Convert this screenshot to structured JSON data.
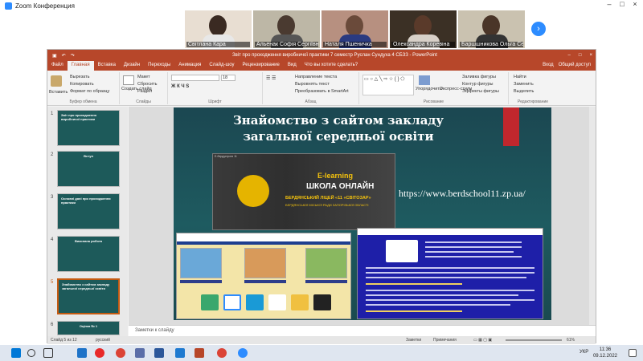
{
  "zoom": {
    "window_title": "Zoom Конференция",
    "participants": [
      {
        "name": "Світлана Кара",
        "bg": "#e8ded2",
        "hair": "#3a2a22",
        "shirt": "#e8e8e8"
      },
      {
        "name": "Альенак Софія Сергіївна",
        "bg": "#bdb7a6",
        "hair": "#4a3a30",
        "shirt": "#555555"
      },
      {
        "name": "Наталя Пшеничка",
        "bg": "#b79080",
        "hair": "#6a4a3a",
        "shirt": "#2a3a80"
      },
      {
        "name": "Олександра Коревіна",
        "bg": "#3b3025",
        "hair": "#5a3a2a",
        "shirt": "#d8d0c8"
      },
      {
        "name": "Баршшникова Ольга Сер...",
        "bg": "#cac2b0",
        "hair": "#4a3528",
        "shirt": "#333333"
      }
    ],
    "next_icon": "chevron-right-icon"
  },
  "ppt": {
    "title": "Звіт про проходження виробничої практики 7 семестр Руслан Сундуха 4 СБЗЗ - PowerPoint",
    "tabs": [
      "Файл",
      "Главная",
      "Вставка",
      "Дизайн",
      "Переходы",
      "Анимация",
      "Слайд-шоу",
      "Рецензирование",
      "Вид",
      "Что вы хотите сделать?"
    ],
    "active_tab": "Главная",
    "tab_right": [
      "Вход",
      "Общий доступ"
    ],
    "ribbon": {
      "paste": "Вставить",
      "cut": "Вырезать",
      "copy": "Копировать",
      "format_painter": "Формат по образцу",
      "clipboard_group": "Буфер обмена",
      "new_slide": "Создать слайд",
      "layout": "Макет",
      "reset": "Сбросить",
      "section": "Раздел",
      "slides_group": "Слайды",
      "font_size": "18",
      "font_group": "Шрифт",
      "text_direction": "Направление текста",
      "align_text": "Выровнять текст",
      "smartart": "Преобразовать в SmartArt",
      "paragraph_group": "Абзац",
      "arrange": "Упорядочить",
      "express_styles": "Экспресс-стили",
      "shape_fill": "Заливка фигуры",
      "shape_outline": "Контур фигуры",
      "shape_effects": "Эффекты фигуры",
      "drawing_group": "Рисование",
      "find": "Найти",
      "replace": "Заменить",
      "select": "Выделить",
      "editing_group": "Редактирование"
    },
    "thumbnails": [
      {
        "num": "1",
        "label": "Звіт про проходження виробничої практики"
      },
      {
        "num": "2",
        "label": "Вступ"
      },
      {
        "num": "3",
        "label": "Основні дані про проходження практики"
      },
      {
        "num": "4",
        "label": "Виконана робота"
      },
      {
        "num": "5",
        "label": "Знайомство з сайтом закладу загальної середньої освіти"
      },
      {
        "num": "6",
        "label": "Оцінка № 1"
      }
    ],
    "slide": {
      "title_line1": "Знайомство з сайтом закладу",
      "title_line2": "загальної середньої освіти",
      "url": "https://www.berdschool11.zp.ua/",
      "banner_header": "Е-бердуєгроги 11",
      "banner_elearning": "E-learning",
      "banner_school": "ШКОЛА ОНЛАЙН",
      "banner_lyceum": "БЕРДЯНСЬКИЙ ЛІЦЕЙ «11 «СВІТОЗАР»",
      "banner_council": "БЕРДЯНСЬКОЇ МІСЬКОЇ РАДИ ЗАПОРІЗЬКОЇ ОБЛАСТІ"
    },
    "notes_placeholder": "Заметки к слайду",
    "status": {
      "slide_info": "Слайд 5 из 12",
      "language": "русский",
      "notes": "Заметки",
      "comments": "Примечания",
      "zoom": "61%"
    }
  },
  "taskbar": {
    "time": "11:36",
    "date": "09.12.2022",
    "lang": "УКР"
  },
  "colors": {
    "ppt_accent": "#b7472a",
    "zoom_blue": "#2d8cff",
    "slide_bg": "#1c4d55"
  }
}
